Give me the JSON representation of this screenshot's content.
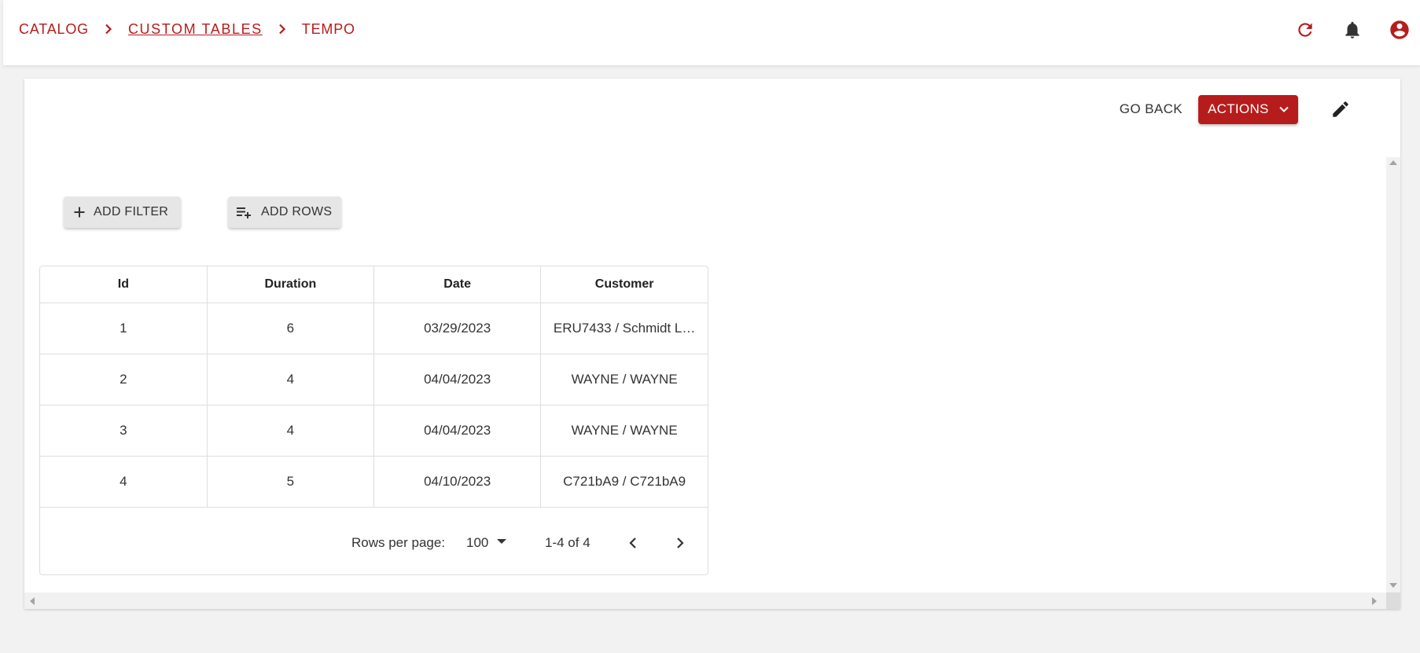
{
  "breadcrumb": {
    "items": [
      {
        "label": "CATALOG",
        "link": false
      },
      {
        "label": "CUSTOM TABLES",
        "link": true
      },
      {
        "label": "TEMPO",
        "link": false
      }
    ]
  },
  "header": {
    "icons": [
      "refresh-icon",
      "bell-icon",
      "account-circle-icon"
    ]
  },
  "card": {
    "go_back_label": "GO BACK",
    "actions_label": "ACTIONS"
  },
  "toolbar": {
    "add_filter_label": "ADD FILTER",
    "add_rows_label": "ADD ROWS"
  },
  "table": {
    "columns": [
      "Id",
      "Duration",
      "Date",
      "Customer"
    ],
    "rows": [
      [
        "1",
        "6",
        "03/29/2023",
        "ERU7433 / Schmidt L…"
      ],
      [
        "2",
        "4",
        "04/04/2023",
        "WAYNE / WAYNE"
      ],
      [
        "3",
        "4",
        "04/04/2023",
        "WAYNE / WAYNE"
      ],
      [
        "4",
        "5",
        "04/10/2023",
        "C721bA9 / C721bA9"
      ]
    ]
  },
  "pagination": {
    "rows_per_page_label": "Rows per page:",
    "rows_per_page_value": "100",
    "range_label": "1-4 of 4"
  },
  "colors": {
    "accent": "#b71c1c",
    "background": "#f2f2f2",
    "card": "#ffffff"
  }
}
